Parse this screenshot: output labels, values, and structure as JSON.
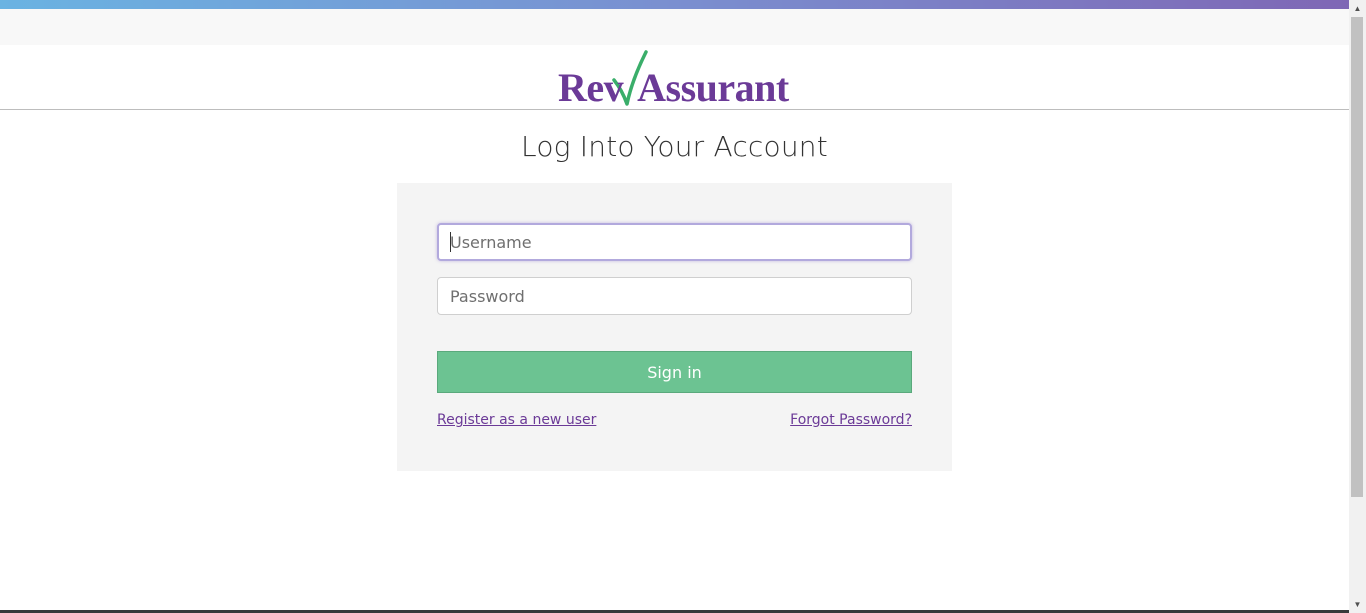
{
  "brand": {
    "name": "RevAssurant",
    "prefix": "Rev",
    "suffix": "Assurant",
    "color": "#6b3a97",
    "check_color": "#3aae6a"
  },
  "login": {
    "title": "Log Into Your Account",
    "username_placeholder": "Username",
    "password_placeholder": "Password",
    "signin_label": "Sign in",
    "register_link": "Register as a new user",
    "forgot_link": "Forgot Password?"
  },
  "colors": {
    "accent_green": "#6cc392",
    "link_purple": "#6b3a97",
    "card_bg": "#f4f4f4"
  },
  "icons": {
    "scroll_up": "triangle-up",
    "scroll_down": "triangle-down",
    "logo_check": "checkmark"
  }
}
